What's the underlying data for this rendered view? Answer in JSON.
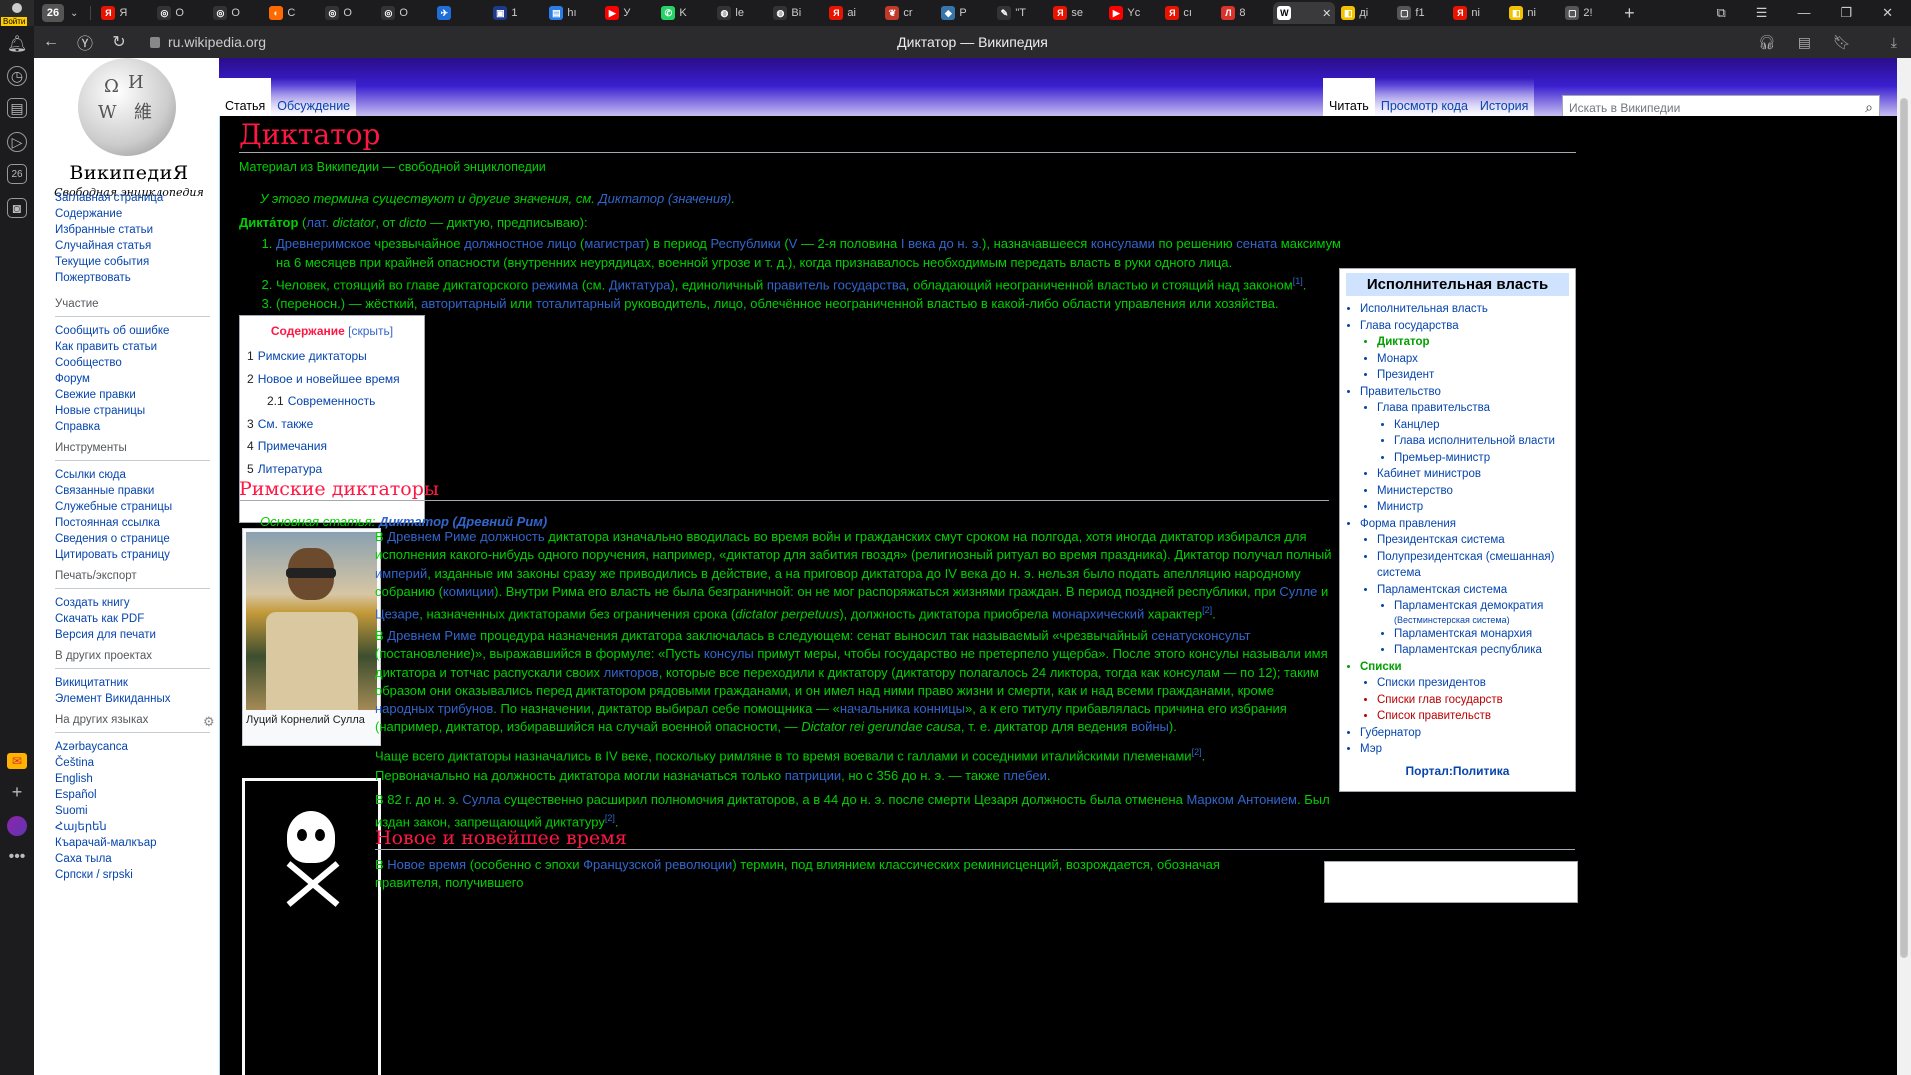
{
  "browser": {
    "profile_label": "Войти",
    "tab_count": "26",
    "tabs": [
      {
        "label": "Я",
        "color": "#e61400",
        "glyph": "Я"
      },
      {
        "label": "О",
        "color": "#333333",
        "glyph": "◎"
      },
      {
        "label": "О",
        "color": "#333333",
        "glyph": "◎"
      },
      {
        "label": "С",
        "color": "#ff6a00",
        "glyph": "◐"
      },
      {
        "label": "О",
        "color": "#333333",
        "glyph": "◎"
      },
      {
        "label": "О",
        "color": "#333333",
        "glyph": "◎"
      },
      {
        "label": "",
        "color": "#1e6fd9",
        "glyph": "✈"
      },
      {
        "label": "1",
        "color": "#1e3a8a",
        "glyph": "▣"
      },
      {
        "label": "hı",
        "color": "#2b7de9",
        "glyph": "▤"
      },
      {
        "label": "У",
        "color": "#ff0000",
        "glyph": "▶"
      },
      {
        "label": "K",
        "color": "#25d366",
        "glyph": "✆"
      },
      {
        "label": "le",
        "color": "#333333",
        "glyph": "◍"
      },
      {
        "label": "Bi",
        "color": "#333333",
        "glyph": "◍"
      },
      {
        "label": "ai",
        "color": "#e61400",
        "glyph": "Я"
      },
      {
        "label": "cr",
        "color": "#c0392b",
        "glyph": "❦"
      },
      {
        "label": "Р",
        "color": "#3776ab",
        "glyph": "◆"
      },
      {
        "label": "\"Т",
        "color": "#333333",
        "glyph": "✎"
      },
      {
        "label": "se",
        "color": "#e61400",
        "glyph": "Я"
      },
      {
        "label": "Yc",
        "color": "#ff0000",
        "glyph": "▶"
      },
      {
        "label": "cı",
        "color": "#e61400",
        "glyph": "Я"
      },
      {
        "label": "8",
        "color": "#d9342b",
        "glyph": "Л"
      },
      {
        "label": "",
        "color": "#ffffff",
        "glyph": "W",
        "active": true
      },
      {
        "label": "ді",
        "color": "#f2c200",
        "glyph": "◧"
      },
      {
        "label": "f1",
        "color": "#555555",
        "glyph": "▢"
      },
      {
        "label": "ni",
        "color": "#e61400",
        "glyph": "Я"
      },
      {
        "label": "ni",
        "color": "#f2c200",
        "glyph": "◧"
      },
      {
        "label": "2!",
        "color": "#555555",
        "glyph": "▢"
      }
    ],
    "url": "ru.wikipedia.org",
    "page_title": "Диктатор — Википедия"
  },
  "wiki": {
    "logo_title": "ВикипедиЯ",
    "logo_subtitle": "Свободная энциклопедия",
    "nav_main": [
      "Заглавная страница",
      "Содержание",
      "Избранные статьи",
      "Случайная статья",
      "Текущие события",
      "Пожертвовать"
    ],
    "participation_title": "Участие",
    "participation": [
      "Сообщить об ошибке",
      "Как править статьи",
      "Сообщество",
      "Форум",
      "Свежие правки",
      "Новые страницы",
      "Справка"
    ],
    "tools_title": "Инструменты",
    "tools": [
      "Ссылки сюда",
      "Связанные правки",
      "Служебные страницы",
      "Постоянная ссылка",
      "Сведения о странице",
      "Цитировать страницу"
    ],
    "print_title": "Печать/экспорт",
    "print": [
      "Создать книгу",
      "Скачать как PDF",
      "Версия для печати"
    ],
    "projects_title": "В других проектах",
    "projects": [
      "Викицитатник",
      "Элемент Викиданных"
    ],
    "languages_title": "На других языках",
    "languages": [
      "Azərbaycanca",
      "Čeština",
      "English",
      "Español",
      "Suomi",
      "Հայերեն",
      "Къарачай-малкъар",
      "Саха тыла",
      "Српски / srpski"
    ],
    "tab_article": "Статья",
    "tab_talk": "Обсуждение",
    "tab_read": "Читать",
    "tab_source": "Просмотр кода",
    "tab_history": "История",
    "search_placeholder": "Искать в Википедии"
  },
  "article": {
    "title": "Диктатор",
    "tagline": "Материал из Википедии — свободной энциклопедии",
    "hatnote_prefix": "У этого термина существуют и другие значения, см. ",
    "hatnote_link": "Диктатор (значения)",
    "lede_term": "Дикта́тор",
    "lede_lang": "лат.",
    "lede_latin": "dictator",
    "lede_from": ", от ",
    "lede_dicto": "dicto",
    "lede_rest": " — диктую, предписываю):",
    "definitions": [
      "Древнеримское чрезвычайное должностное лицо (магистрат) в период Республики (V — 2-я половина I века до н. э.), назначавшееся консулами по решению сената максимум на 6 месяцев при крайней опасности (внутренних неурядицах, военной угрозе и т. д.), когда признавалось необходимым передать власть в руки одного лица.",
      "Человек, стоящий во главе диктаторского режима (см. Диктатура), единоличный правитель государства, обладающий неограниченной властью и стоящий над законом[1].",
      "(переносн.) — жёсткий, авторитарный или тоталитарный руководитель, лицо, облечённое неограниченной властью в какой-либо области управления или хозяйства."
    ],
    "toc_title": "Содержание",
    "toc_hide": "скрыть",
    "toc": [
      {
        "num": "1",
        "label": "Римские диктаторы"
      },
      {
        "num": "2",
        "label": "Новое и новейшее время"
      },
      {
        "num": "2.1",
        "label": "Современность"
      },
      {
        "num": "3",
        "label": "См. также"
      },
      {
        "num": "4",
        "label": "Примечания"
      },
      {
        "num": "5",
        "label": "Литература"
      }
    ],
    "section1_title": "Римские диктаторы",
    "main_article_prefix": "Основная статья: ",
    "main_article_link": "Диктатор (Древний Рим)",
    "thumb_caption": "Луций Корнелий Сулла",
    "paragraphs": [
      "В Древнем Риме должность диктатора изначально вводилась во время войн и гражданских смут сроком на полгода, хотя иногда диктатор избирался для исполнения какого-нибудь одного поручения, например, «диктатор для забития гвоздя» (религиозный ритуал во время праздника). Диктатор получал полный империй, изданные им законы сразу же приводились в действие, а на приговор диктатора до IV века до н. э. нельзя было подать апелляцию народному собранию (комиции). Внутри Рима его власть не была безграничной: он не мог распоряжаться жизнями граждан. В период поздней республики, при Сулле и Цезаре, назначенных диктаторами без ограничения срока (dictator perpetuus), должность диктатора приобрела монархический характер[2].",
      "В Древнем Риме процедура назначения диктатора заключалась в следующем: сенат выносил так называемый «чрезвычайный сенатусконсульт (постановление)», выражавшийся в формуле: «Пусть консулы примут меры, чтобы государство не претерпело ущерба». После этого консулы называли имя диктатора и тотчас распускали своих ликторов, которые все переходили к диктатору (диктатору полагалось 24 ликтора, тогда как консулам — по 12); таким образом они оказывались перед диктатором рядовыми гражданами, и он имел над ними право жизни и смерти, как и над всеми гражданами, кроме народных трибунов. По назначении, диктатор выбирал себе помощника — «начальника конницы», а к его титулу прибавлялась причина его избрания (например, диктатор, избиравшийся на случай военной опасности, — Dictator rei gerundae causa, т. е. диктатор для ведения войны).",
      "Чаще всего диктаторы назначались в IV веке, поскольку римляне в то время воевали с галлами и соседними италийскими племенами[2].",
      "Первоначально на должность диктатора могли назначаться только патриции, но с 356 до н. э. — также плебеи.",
      "В 82 г. до н. э. Сулла существенно расширил полномочия диктаторов, а в 44 до н. э. после смерти Цезаря должность была отменена Марком Антонием. Был издан закон, запрещающий диктатуру[2]."
    ],
    "section2_title": "Новое и новейшее время",
    "section2_para": "В Новое время (особенно с эпохи Французской революции) термин, под влиянием классических реминисценций, возрождается, обозначая правителя, получившего"
  },
  "infobox": {
    "title": "Исполнительная власть",
    "items": [
      {
        "level": 1,
        "label": "Исполнительная власть"
      },
      {
        "level": 1,
        "label": "Глава государства"
      },
      {
        "level": 2,
        "label": "Диктатор",
        "selected": true
      },
      {
        "level": 2,
        "label": "Монарх"
      },
      {
        "level": 2,
        "label": "Президент"
      },
      {
        "level": 1,
        "label": "Правительство"
      },
      {
        "level": 2,
        "label": "Глава правительства"
      },
      {
        "level": 3,
        "label": "Канцлер"
      },
      {
        "level": 3,
        "label": "Глава исполнительной власти"
      },
      {
        "level": 3,
        "label": "Премьер-министр"
      },
      {
        "level": 2,
        "label": "Кабинет министров"
      },
      {
        "level": 2,
        "label": "Министерство"
      },
      {
        "level": 2,
        "label": "Министр"
      },
      {
        "level": 1,
        "label": "Форма правления"
      },
      {
        "level": 2,
        "label": "Президентская система"
      },
      {
        "level": 2,
        "label": "Полупрезидентская (смешанная) система"
      },
      {
        "level": 2,
        "label": "Парламентская система"
      },
      {
        "level": 3,
        "label": "Парламентская демократия"
      },
      {
        "level": 3,
        "label": "(Вестминстерская система)",
        "small": true
      },
      {
        "level": 3,
        "label": "Парламентская монархия"
      },
      {
        "level": 3,
        "label": "Парламентская республика"
      },
      {
        "level": 1,
        "label": "Списки",
        "selected": true
      },
      {
        "level": 2,
        "label": "Списки президентов"
      },
      {
        "level": 2,
        "label": "Списки глав государств",
        "red": true
      },
      {
        "level": 2,
        "label": "Список правительств",
        "red": true
      },
      {
        "level": 1,
        "label": "Губернатор"
      },
      {
        "level": 1,
        "label": "Мэр"
      }
    ],
    "footer": "Портал:Политика"
  }
}
